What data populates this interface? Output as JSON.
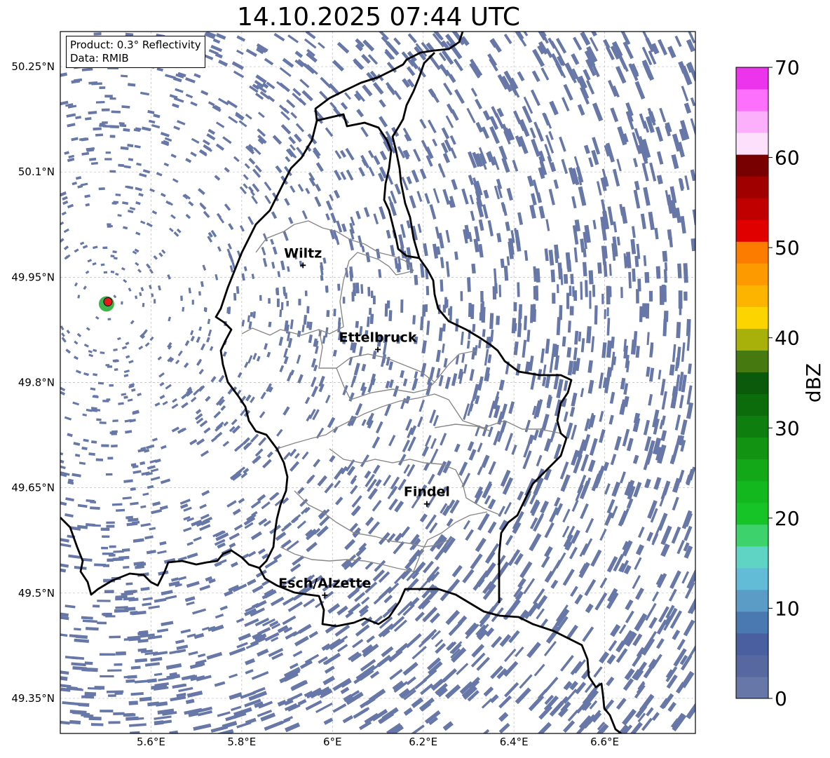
{
  "title": "14.10.2025 07:44 UTC",
  "info": {
    "product": "Product: 0.3° Reflectivity",
    "data": "Data: RMIB"
  },
  "axes": {
    "lon_min": 5.4,
    "lon_max": 6.8,
    "lat_min": 49.3,
    "lat_max": 50.3,
    "lat_ticks": [
      {
        "value": 50.25,
        "label": "50.25°N"
      },
      {
        "value": 50.1,
        "label": "50.1°N"
      },
      {
        "value": 49.95,
        "label": "49.95°N"
      },
      {
        "value": 49.8,
        "label": "49.8°N"
      },
      {
        "value": 49.65,
        "label": "49.65°N"
      },
      {
        "value": 49.5,
        "label": "49.5°N"
      },
      {
        "value": 49.35,
        "label": "49.35°N"
      }
    ],
    "lon_ticks": [
      {
        "value": 5.6,
        "label": "5.6°E"
      },
      {
        "value": 5.8,
        "label": "5.8°E"
      },
      {
        "value": 6.0,
        "label": "6°E"
      },
      {
        "value": 6.2,
        "label": "6.2°E"
      },
      {
        "value": 6.4,
        "label": "6.4°E"
      },
      {
        "value": 6.6,
        "label": "6.6°E"
      }
    ],
    "grid": true
  },
  "cities": [
    {
      "name": "Wiltz",
      "lon": 5.935,
      "lat": 49.967
    },
    {
      "name": "Ettelbruck",
      "lon": 6.1,
      "lat": 49.847
    },
    {
      "name": "Findel",
      "lon": 6.208,
      "lat": 49.627
    },
    {
      "name": "Esch/Alzette",
      "lon": 5.983,
      "lat": 49.497
    }
  ],
  "radar_site": {
    "lon": 5.505,
    "lat": 49.915
  },
  "colorbar": {
    "label": "dBZ",
    "min": 0,
    "max": 70,
    "ticks": [
      "0",
      "10",
      "20",
      "30",
      "40",
      "50",
      "60",
      "70"
    ],
    "colors": [
      "#6677a8",
      "#56689f",
      "#4a5fa0",
      "#4a78b0",
      "#5a9cc6",
      "#62bcd8",
      "#60d4c4",
      "#3ed26c",
      "#16c428",
      "#12b81e",
      "#12a818",
      "#129412",
      "#0e7e0e",
      "#0c6c0c",
      "#0b5a0b",
      "#467a10",
      "#a8b00a",
      "#fcd400",
      "#fcb400",
      "#fc9a00",
      "#fc7c00",
      "#e00000",
      "#c00000",
      "#a00000",
      "#780000",
      "#fce0fc",
      "#fcb0fc",
      "#fc70fc",
      "#ec34ec"
    ]
  },
  "echo_color": "#6677a8",
  "border_color": "#000000",
  "canton_color": "#888888"
}
